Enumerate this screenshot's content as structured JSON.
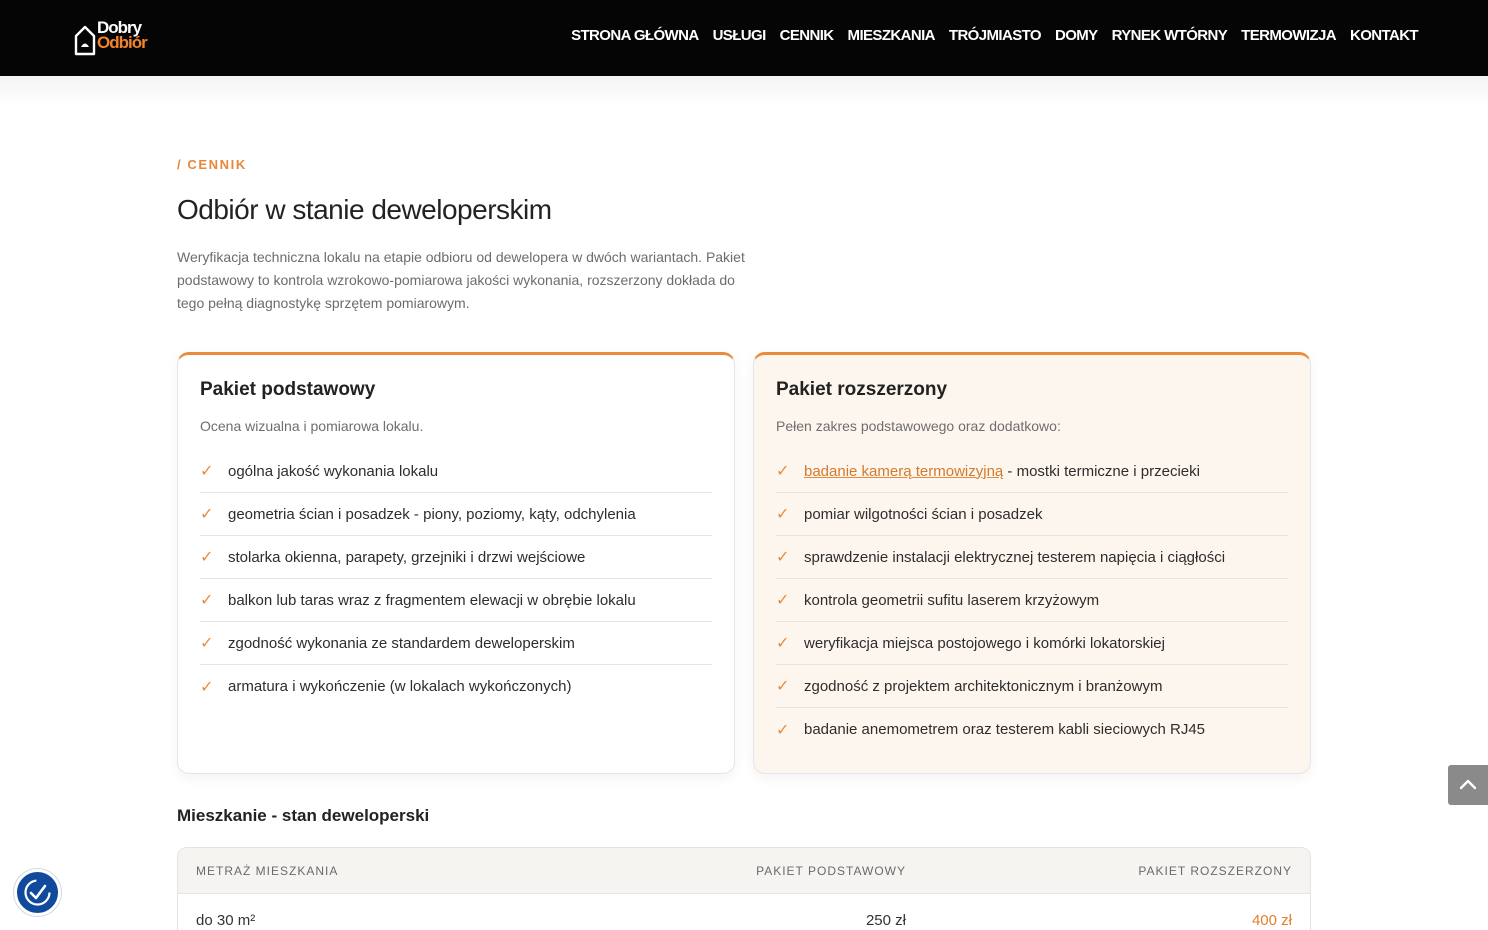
{
  "brand": {
    "line1": "Dobry",
    "line2": "Odbiór",
    "accent": "#ec8a3b"
  },
  "nav": {
    "items": [
      {
        "label": "STRONA GŁÓWNA"
      },
      {
        "label": "USŁUGI"
      },
      {
        "label": "CENNIK"
      },
      {
        "label": "MIESZKANIA"
      },
      {
        "label": "TRÓJMIASTO"
      },
      {
        "label": "DOMY"
      },
      {
        "label": "RYNEK WTÓRNY"
      },
      {
        "label": "TERMOWIZJA"
      },
      {
        "label": "KONTAKT"
      }
    ]
  },
  "intro": {
    "eyebrow": "/ CENNIK",
    "title": "Odbiór w stanie deweloperskim",
    "text": "Weryfikacja techniczna lokalu na etapie odbioru od dewelopera w dwóch wariantach. Pakiet podstawowy to kontrola wzrokowo-pomiarowa jakości wykonania, rozszerzony dokłada do tego pełną diagnostykę sprzętem pomiarowym."
  },
  "packages": {
    "basic": {
      "title": "Pakiet podstawowy",
      "subtitle": "Ocena wizualna i pomiarowa lokalu.",
      "features": [
        "ogólna jakość wykonania lokalu",
        "geometria ścian i posadzek - piony, poziomy, kąty, odchylenia",
        "stolarka okienna, parapety, grzejniki i drzwi wejściowe",
        "balkon lub taras wraz z fragmentem elewacji w obrębie lokalu",
        "zgodność wykonania ze standardem deweloperskim",
        "armatura i wykończenie (w lokalach wykończonych)"
      ]
    },
    "extended": {
      "title": "Pakiet rozszerzony",
      "subtitle": "Pełen zakres podstawowego oraz dodatkowo:",
      "first_link": "badanie kamerą termowizyjną",
      "first_rest": " - mostki termiczne i przecieki",
      "features": [
        "pomiar wilgotności ścian i posadzek",
        "sprawdzenie instalacji elektrycznej testerem napięcia i ciągłości",
        "kontrola geometrii sufitu laserem krzyżowym",
        "weryfikacja miejsca postojowego i komórki lokatorskiej",
        "zgodność z projektem architektonicznym i branżowym",
        "badanie anemometrem oraz testerem kabli sieciowych RJ45"
      ]
    }
  },
  "price_table": {
    "title": "Mieszkanie - stan deweloperski",
    "headers": [
      "METRAŻ MIESZKANIA",
      "PAKIET PODSTAWOWY",
      "PAKIET ROZSZERZONY"
    ],
    "rows": [
      {
        "area": "do 30 m²",
        "basic": "250 zł",
        "extended": "400 zł"
      }
    ]
  },
  "icons": {
    "check": "✓",
    "scroll_top": "chevron-up-icon",
    "accessibility": "accessibility-icon"
  }
}
